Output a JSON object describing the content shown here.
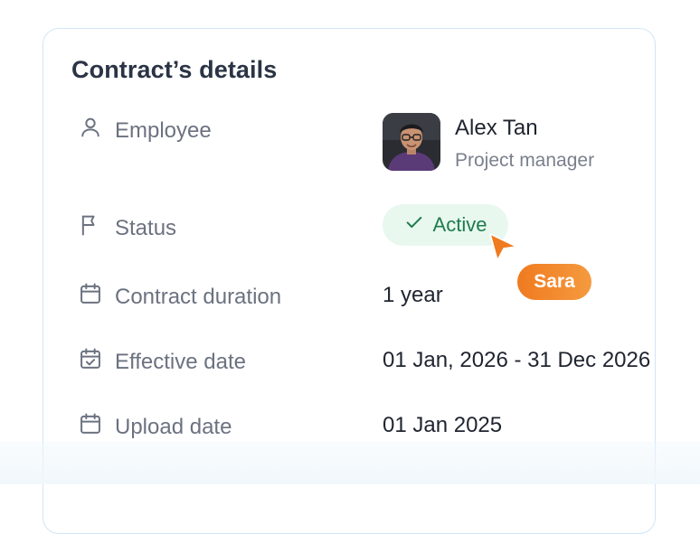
{
  "card": {
    "title": "Contract’s details",
    "rows": [
      {
        "label": "Employee",
        "icon": "user-icon"
      },
      {
        "label": "Status",
        "icon": "flag-icon"
      },
      {
        "label": "Contract duration",
        "icon": "calendar-icon",
        "value": "1 year"
      },
      {
        "label": "Effective date",
        "icon": "calendar-check-icon",
        "value": "01 Jan, 2026 - 31 Dec 2026"
      },
      {
        "label": "Upload date",
        "icon": "calendar-icon",
        "value": "01 Jan 2025"
      }
    ],
    "employee": {
      "name": "Alex Tan",
      "role": "Project manager"
    },
    "status": {
      "label": "Active",
      "icon": "check-icon",
      "color": "#1e7b4d",
      "background": "#e8f8ef"
    }
  },
  "collaborator": {
    "name": "Sara",
    "color": "#f07a1f"
  }
}
